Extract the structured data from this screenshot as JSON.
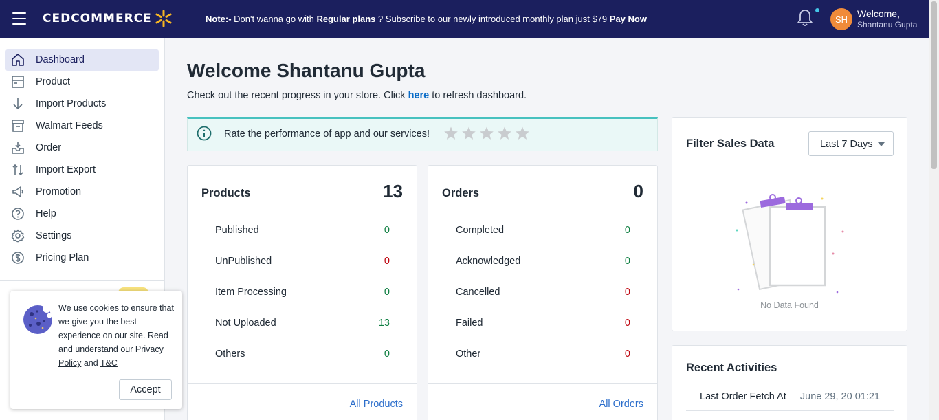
{
  "topbar": {
    "logo_text": "CEDCOMMERCE",
    "note_prefix": "Note:-",
    "note_part1": " Don't wanna go with ",
    "note_bold1": "Regular plans",
    "note_part2": " ? Subscribe to our newly introduced monthly plan just $79 ",
    "note_cta": "Pay Now",
    "avatar_initials": "SH",
    "welcome_label": "Welcome,",
    "user_name": "Shantanu Gupta"
  },
  "sidebar": {
    "items": [
      {
        "label": "Dashboard",
        "icon": "home-icon",
        "active": true
      },
      {
        "label": "Product",
        "icon": "product-icon"
      },
      {
        "label": "Import Products",
        "icon": "arrow-down-icon"
      },
      {
        "label": "Walmart Feeds",
        "icon": "archive-icon"
      },
      {
        "label": "Order",
        "icon": "inbox-icon"
      },
      {
        "label": "Import Export",
        "icon": "transfer-icon"
      },
      {
        "label": "Promotion",
        "icon": "megaphone-icon"
      },
      {
        "label": "Help",
        "icon": "question-icon"
      },
      {
        "label": "Settings",
        "icon": "gear-icon"
      },
      {
        "label": "Pricing Plan",
        "icon": "dollar-icon"
      }
    ]
  },
  "main": {
    "title": "Welcome Shantanu Gupta",
    "subtitle_part1": "Check out the recent progress in your store. Click ",
    "subtitle_link": "here",
    "subtitle_part2": " to refresh dashboard.",
    "rate_text": "Rate the performance of app and our services!",
    "rating": 0
  },
  "products_card": {
    "title": "Products",
    "count": "13",
    "rows": [
      {
        "label": "Published",
        "value": "0",
        "color": "green"
      },
      {
        "label": "UnPublished",
        "value": "0",
        "color": "red"
      },
      {
        "label": "Item Processing",
        "value": "0",
        "color": "green"
      },
      {
        "label": "Not Uploaded",
        "value": "13",
        "color": "green"
      },
      {
        "label": "Others",
        "value": "0",
        "color": "green"
      }
    ],
    "link": "All Products"
  },
  "orders_card": {
    "title": "Orders",
    "count": "0",
    "rows": [
      {
        "label": "Completed",
        "value": "0",
        "color": "green"
      },
      {
        "label": "Acknowledged",
        "value": "0",
        "color": "green"
      },
      {
        "label": "Cancelled",
        "value": "0",
        "color": "red"
      },
      {
        "label": "Failed",
        "value": "0",
        "color": "red"
      },
      {
        "label": "Other",
        "value": "0",
        "color": "red"
      }
    ],
    "link": "All Orders"
  },
  "filter_card": {
    "title": "Filter Sales Data",
    "selected": "Last 7 Days",
    "empty_text": "No Data Found"
  },
  "activity_card": {
    "title": "Recent Activities",
    "rows": [
      {
        "label": "Last Order Fetch At",
        "value": "June 29, 20 01:21"
      }
    ]
  },
  "cookie": {
    "text_part1": "We use cookies to ensure that we give you the best experience on our site. Read and understand our ",
    "privacy_link": "Privacy Policy",
    "and_text": " and ",
    "tc_link": "T&C",
    "accept_label": "Accept"
  },
  "colors": {
    "topbar_bg": "#1b1f5e",
    "accent_teal": "#47c1bf",
    "avatar_bg": "#f08b3a",
    "green": "#108043",
    "red": "#bf0711",
    "link": "#2c6ecb"
  }
}
